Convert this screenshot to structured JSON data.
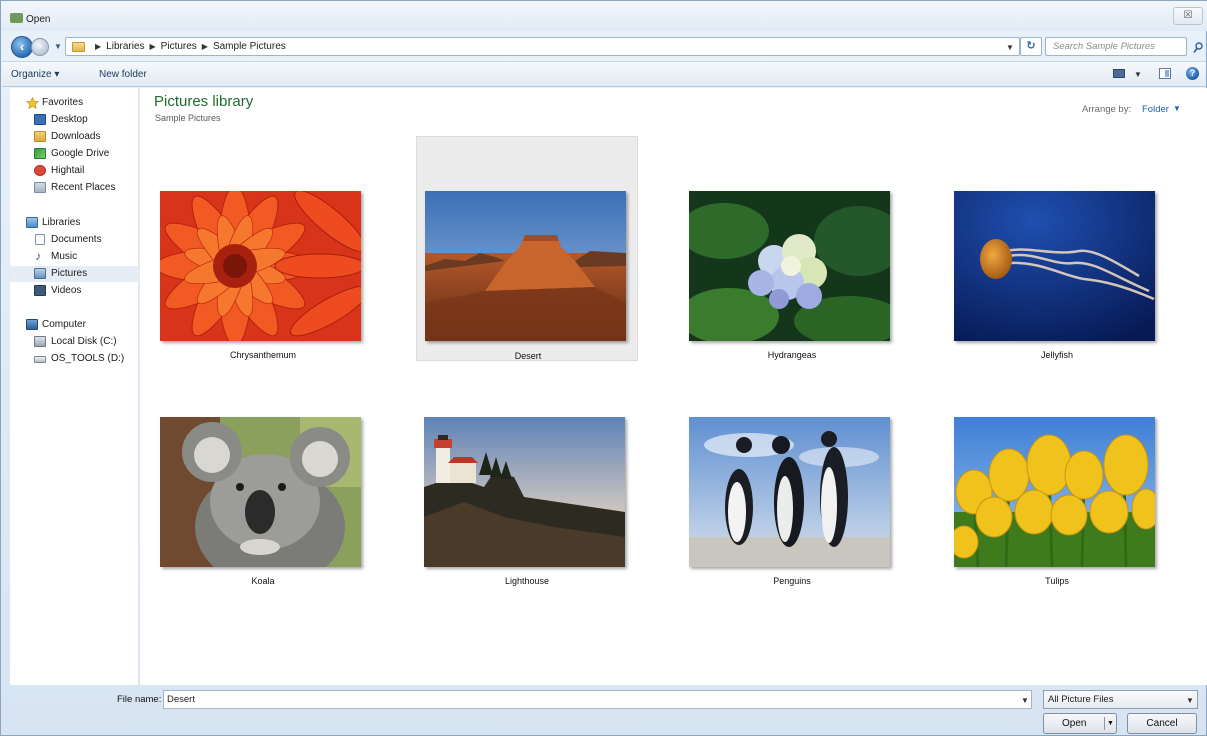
{
  "window": {
    "title": "Open",
    "close_label": "☒"
  },
  "address": {
    "crumbs": [
      "Libraries",
      "Pictures",
      "Sample Pictures"
    ],
    "search_placeholder": "Search Sample Pictures"
  },
  "toolbar": {
    "organize_label": "Organize ▾",
    "new_folder_label": "New folder"
  },
  "sidebar": {
    "items": [
      {
        "label": "Favorites",
        "icon": "star-icon"
      },
      {
        "label": "Desktop",
        "icon": "desktop-icon"
      },
      {
        "label": "Downloads",
        "icon": "downloads-icon"
      },
      {
        "label": "Google Drive",
        "icon": "google-drive-icon"
      },
      {
        "label": "Hightail",
        "icon": "hightail-icon"
      },
      {
        "label": "Recent Places",
        "icon": "recent-places-icon"
      },
      {
        "label": "Libraries",
        "icon": "libraries-icon"
      },
      {
        "label": "Documents",
        "icon": "documents-icon"
      },
      {
        "label": "Music",
        "icon": "music-icon"
      },
      {
        "label": "Pictures",
        "icon": "pictures-icon",
        "selected": true
      },
      {
        "label": "Videos",
        "icon": "videos-icon"
      },
      {
        "label": "Computer",
        "icon": "computer-icon"
      },
      {
        "label": "Local Disk (C:)",
        "icon": "local-disk-icon"
      },
      {
        "label": "OS_TOOLS (D:)",
        "icon": "drive-icon"
      }
    ]
  },
  "main": {
    "title": "Pictures library",
    "subtitle": "Sample Pictures",
    "arrange_label": "Arrange by:",
    "arrange_value": "Folder"
  },
  "files": [
    {
      "name": "Chrysanthemum"
    },
    {
      "name": "Desert",
      "selected": true
    },
    {
      "name": "Hydrangeas"
    },
    {
      "name": "Jellyfish"
    },
    {
      "name": "Koala"
    },
    {
      "name": "Lighthouse"
    },
    {
      "name": "Penguins"
    },
    {
      "name": "Tulips"
    }
  ],
  "bottom": {
    "file_name_label": "File name:",
    "file_name_value": "Desert",
    "filter_value": "All Picture Files",
    "open_label": "Open",
    "cancel_label": "Cancel"
  },
  "colors": {
    "library_title": "#1e6e2e",
    "link_blue": "#1f5fb0",
    "selection": "#e6edf5"
  }
}
